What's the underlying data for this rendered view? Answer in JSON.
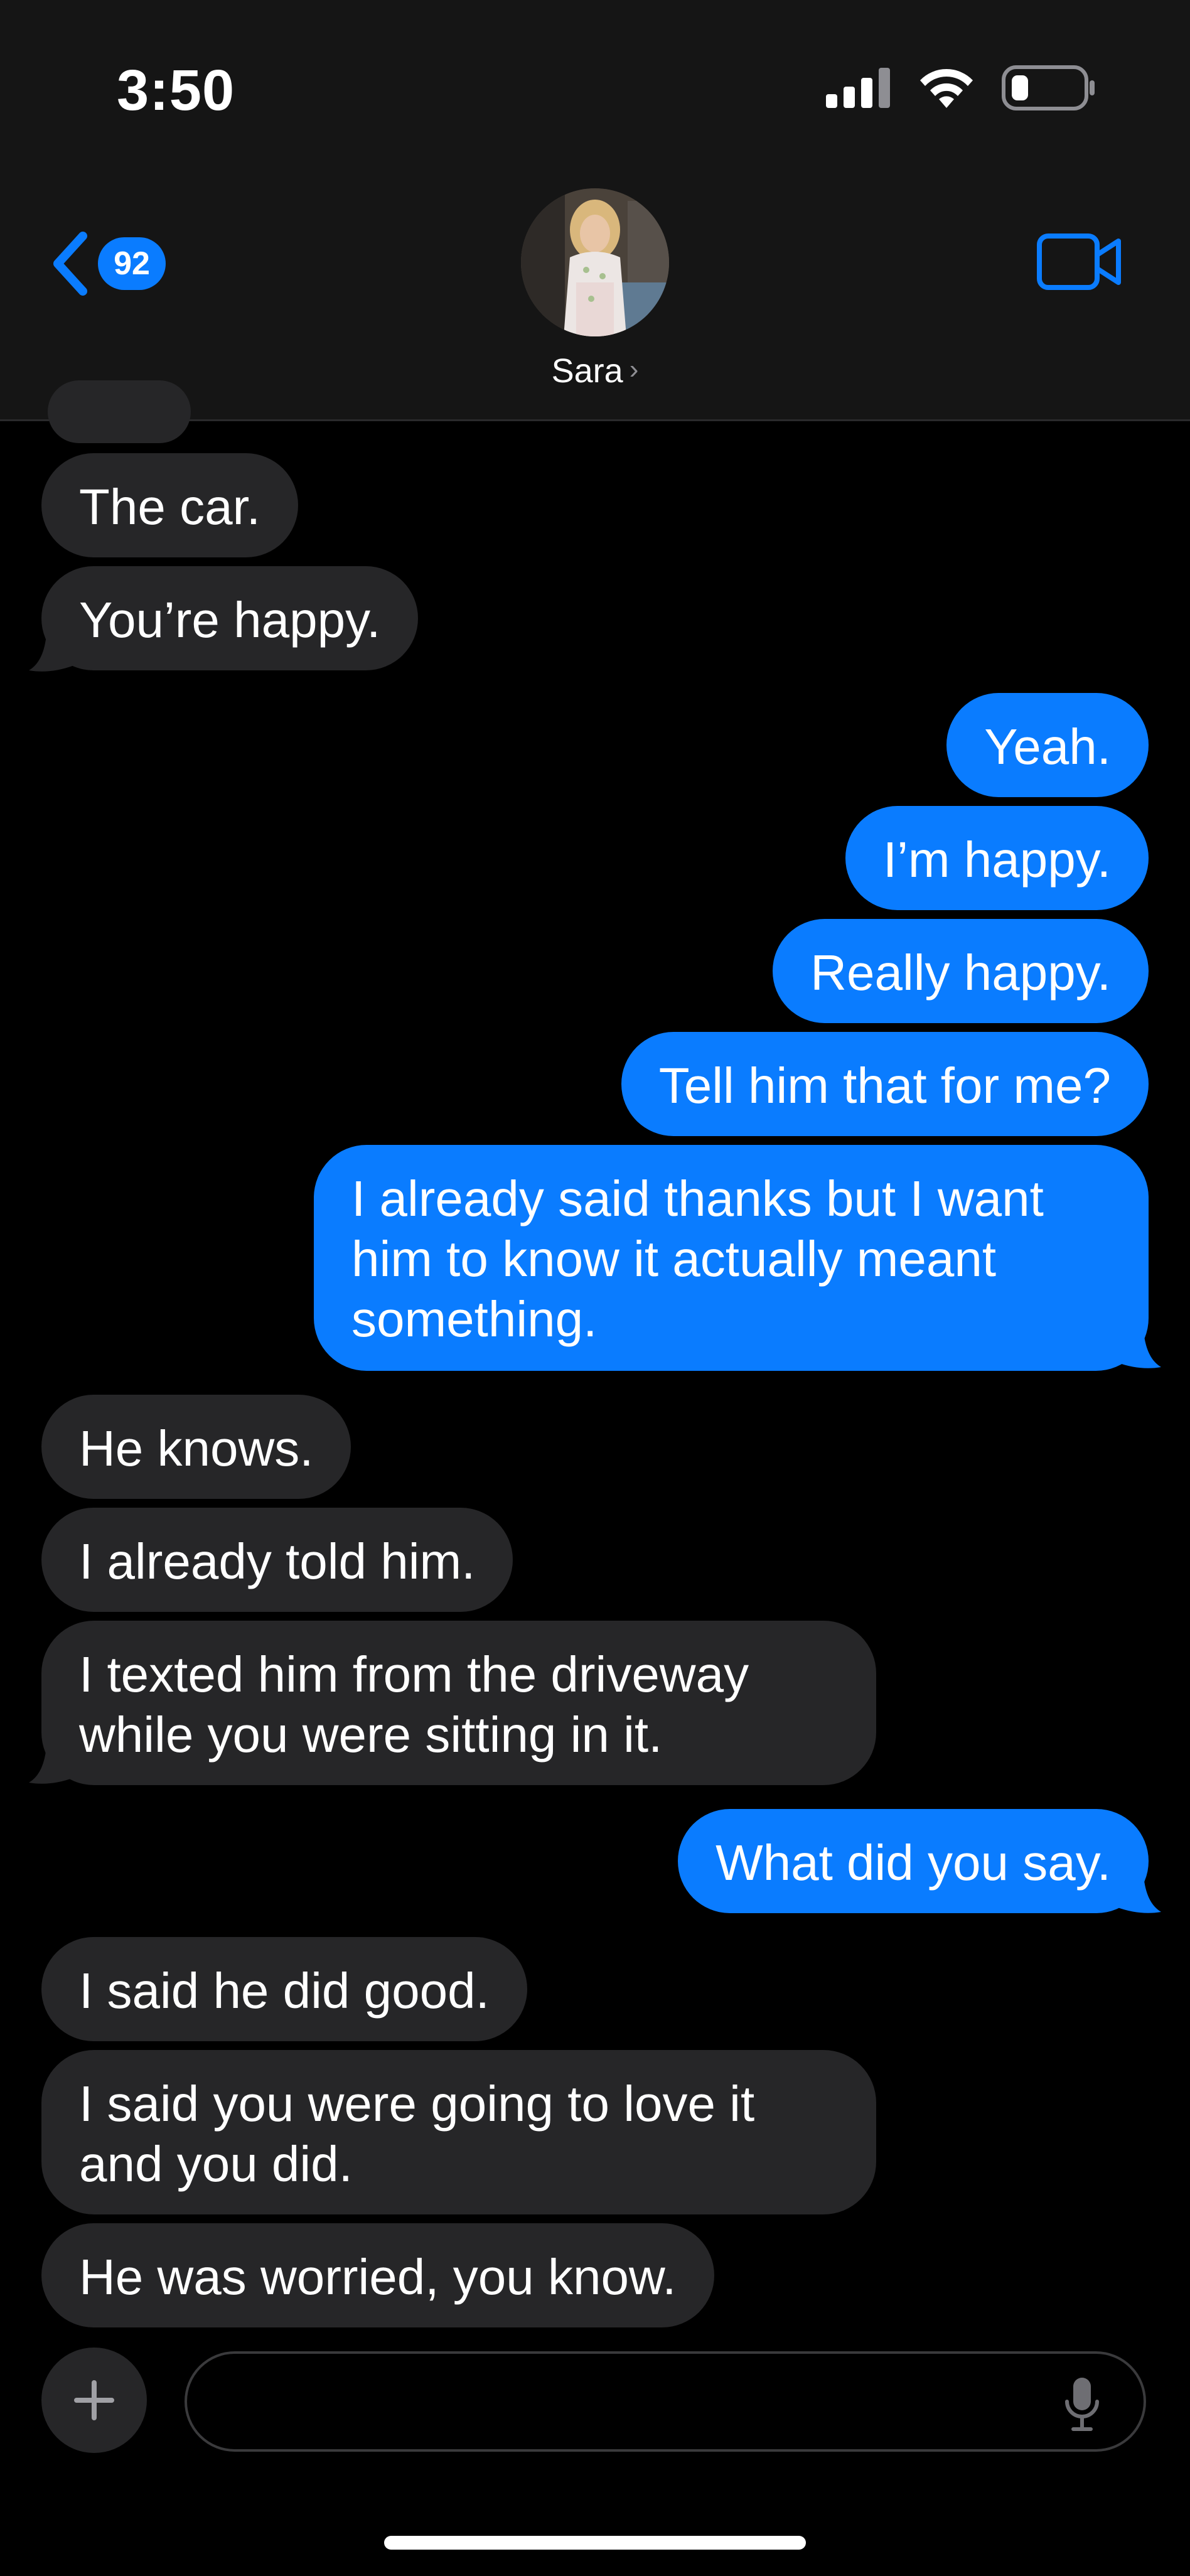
{
  "status_bar": {
    "time": "3:50",
    "icons": [
      "signal-icon",
      "wifi-icon",
      "battery-icon"
    ]
  },
  "header": {
    "back_count": "92",
    "contact_name": "Sara",
    "chevron": "›",
    "video_icon": "video-camera-icon"
  },
  "messages": [
    {
      "from": "them",
      "text": "The car."
    },
    {
      "from": "them",
      "text": "You’re happy."
    },
    {
      "from": "me",
      "text": "Yeah."
    },
    {
      "from": "me",
      "text": "I’m happy."
    },
    {
      "from": "me",
      "text": "Really happy."
    },
    {
      "from": "me",
      "text": "Tell him that for me?"
    },
    {
      "from": "me",
      "text": "I already said thanks but I want him to know it actually meant something."
    },
    {
      "from": "them",
      "text": "He knows."
    },
    {
      "from": "them",
      "text": "I already told him."
    },
    {
      "from": "them",
      "text": "I texted him from the driveway while you were sitting in it."
    },
    {
      "from": "me",
      "text": "What did you say."
    },
    {
      "from": "them",
      "text": "I said he did good."
    },
    {
      "from": "them",
      "text": "I said you were going to love it and you did."
    },
    {
      "from": "them",
      "text": "He was worried, you know."
    }
  ],
  "composer": {
    "placeholder": "",
    "plus_icon": "plus-icon",
    "mic_icon": "microphone-icon"
  },
  "colors": {
    "outgoing": "#0a7cff",
    "incoming": "#262628",
    "background": "#000000",
    "header": "#151515"
  }
}
